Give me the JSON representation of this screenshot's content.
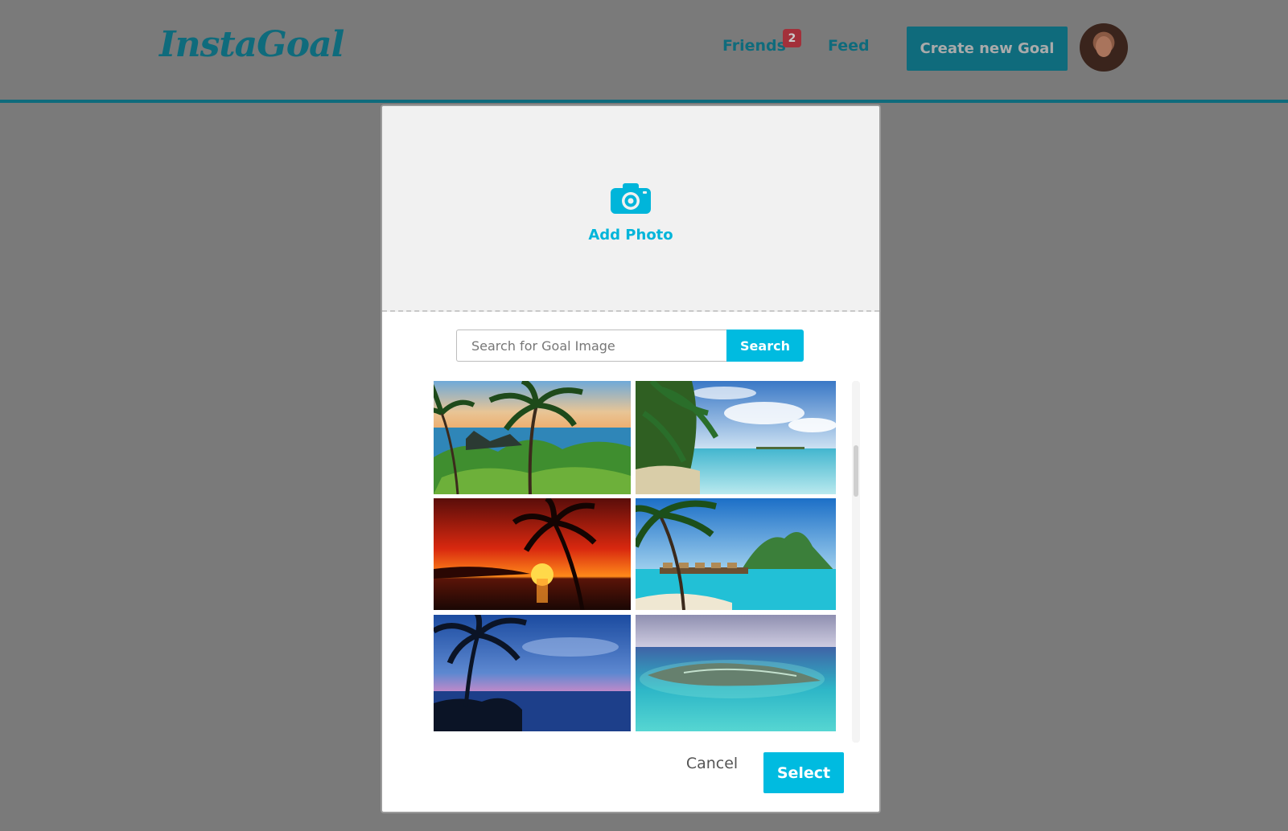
{
  "app": {
    "logo": "InstaGoal"
  },
  "nav": {
    "friends_label": "Friends",
    "friends_badge": "2",
    "feed_label": "Feed",
    "create_label": "Create new Goal"
  },
  "modal": {
    "add_photo_label": "Add Photo",
    "search_placeholder": "Search for Goal Image",
    "search_button": "Search",
    "cancel_label": "Cancel",
    "select_label": "Select",
    "images": [
      {
        "scene": "palms-over-rocky-coast"
      },
      {
        "scene": "palm-beach-clear-water"
      },
      {
        "scene": "red-sunset-palm"
      },
      {
        "scene": "bungalows-turquoise-lagoon"
      },
      {
        "scene": "palm-silhouette-dusk"
      },
      {
        "scene": "aerial-island-reef"
      }
    ]
  },
  "colors": {
    "brand_dark": "#0f6b7c",
    "accent": "#00bbe0",
    "badge": "#a3303a",
    "overlay": "#7a7a7a"
  },
  "icons": [
    "camera-icon"
  ]
}
